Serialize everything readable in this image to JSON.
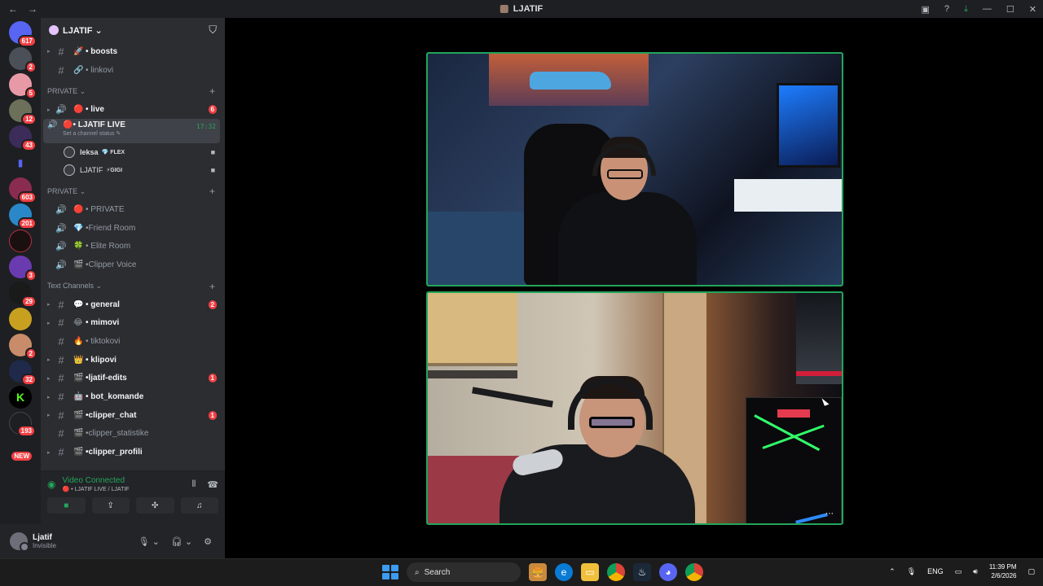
{
  "titlebar": {
    "title": "LJATIF",
    "back": "←",
    "forward": "→"
  },
  "server_badges": [
    "617",
    "2",
    "5",
    "12",
    "43",
    "603",
    "201",
    "3",
    "29",
    "2",
    "32",
    "193",
    "NEW"
  ],
  "server": {
    "name": "LJATIF ⌄"
  },
  "channels_top": [
    {
      "emoji": "🚀",
      "label": "• boosts",
      "bright": true
    },
    {
      "emoji": "🔗",
      "label": "• linkovi",
      "bright": false
    }
  ],
  "cat_private1": "PRIVATE ⌄",
  "voice1": [
    {
      "emoji": "🔴",
      "label": "• live",
      "badge": "6"
    }
  ],
  "active_channel": {
    "label": "• LJATIF LIVE",
    "time": "17:32",
    "status": "Set a channel status ✎"
  },
  "members": [
    {
      "name": "leksa",
      "tag": "💎 FLEX"
    },
    {
      "name": "LJATIF",
      "tag": "⚡GIGI"
    }
  ],
  "cat_private2": "PRIVATE ⌄",
  "voice2": [
    {
      "emoji": "🔴",
      "label": "• PRIVATE"
    },
    {
      "emoji": "💎",
      "label": "•Friend Room"
    },
    {
      "emoji": "🍀",
      "label": "• Elite Room"
    },
    {
      "emoji": "🎬",
      "label": "•Clipper Voice"
    }
  ],
  "cat_text": "Text Channels ⌄",
  "text_channels": [
    {
      "emoji": "💬",
      "label": "• general",
      "badge": "2",
      "bright": true
    },
    {
      "emoji": "😂",
      "label": "• mimovi",
      "badge": "",
      "bright": true
    },
    {
      "emoji": "🔥",
      "label": "• tiktokovi",
      "badge": "",
      "bright": false
    },
    {
      "emoji": "👑",
      "label": "• klipovi",
      "badge": "",
      "bright": true
    },
    {
      "emoji": "🎬",
      "label": "•ljatif-edits",
      "badge": "1",
      "bright": true
    },
    {
      "emoji": "🤖",
      "label": "• bot_komande",
      "badge": "",
      "bright": true
    },
    {
      "emoji": "🎬",
      "label": "•clipper_chat",
      "badge": "1",
      "bright": true
    },
    {
      "emoji": "🎬",
      "label": "•clipper_statistike",
      "badge": "",
      "bright": false
    },
    {
      "emoji": "🎬",
      "label": "•clipper_profili",
      "badge": "",
      "bright": true
    }
  ],
  "voice_panel": {
    "title": "Video Connected",
    "sub": "🔴 • LJATIF LIVE / LJATIF"
  },
  "user": {
    "name": "Ljatif",
    "status": "Invisible"
  },
  "taskbar": {
    "search": "Search",
    "lang": "ENG",
    "time": "11:39 PM",
    "date": "2/6/2026"
  },
  "colors": {
    "accent_green": "#23a55a",
    "mention_red": "#f23f43",
    "sidebar": "#2b2d31"
  }
}
